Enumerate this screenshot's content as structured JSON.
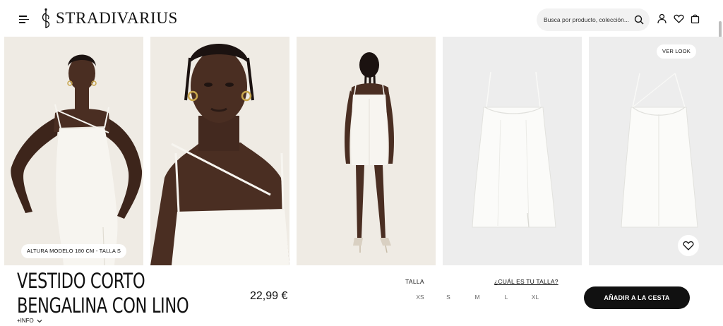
{
  "brand": {
    "name": "STRADIVARIUS"
  },
  "search": {
    "placeholder": "Busca por producto, colección..."
  },
  "header_icons": [
    "menu-icon",
    "search-icon",
    "user-icon",
    "heart-icon",
    "bag-icon"
  ],
  "gallery": {
    "model_info": "ALTURA MODELO 180 CM - TALLA S",
    "look_button": "VER LOOK"
  },
  "product": {
    "title_line1": "VESTIDO CORTO",
    "title_line2": "BENGALINA CON LINO",
    "more_info": "+INFO",
    "price": "22,99 €",
    "size_label": "TALLA",
    "size_guide": "¿CUÁL ES TU TALLA?",
    "sizes": [
      "XS",
      "S",
      "M",
      "L",
      "XL"
    ],
    "add_to_cart": "AÑADIR A LA CESTA"
  },
  "colors": {
    "photo_bg": "#efebe4",
    "flat_bg": "#ededed",
    "skin": "#4a2e22",
    "dress": "#f7f5f0",
    "button": "#111111"
  }
}
